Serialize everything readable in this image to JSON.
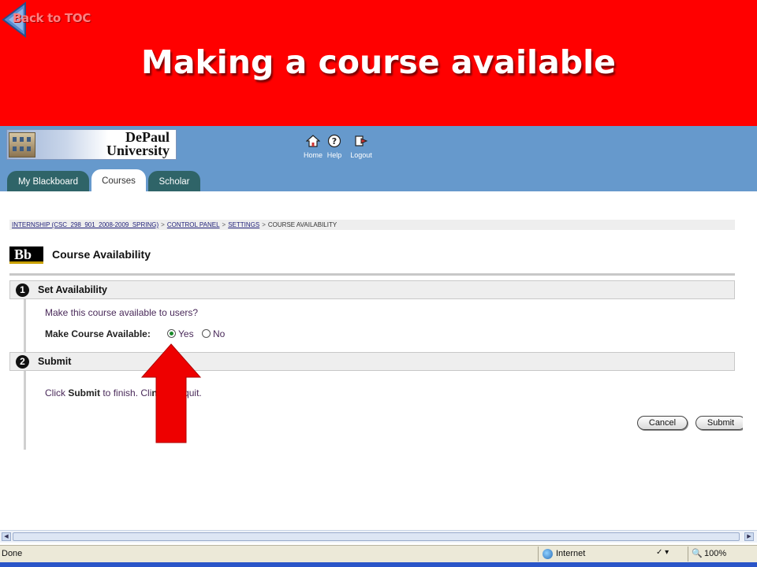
{
  "slide": {
    "back_link": "Back to TOC",
    "title": "Making a course available"
  },
  "header": {
    "logo_line1": "DePaul",
    "logo_line2": "University",
    "icons": [
      {
        "label": "Home",
        "icon": "home-icon"
      },
      {
        "label": "Help",
        "icon": "help-icon"
      },
      {
        "label": "Logout",
        "icon": "logout-icon"
      }
    ]
  },
  "tabs": [
    {
      "label": "My Blackboard",
      "active": false
    },
    {
      "label": "Courses",
      "active": true
    },
    {
      "label": "Scholar",
      "active": false
    }
  ],
  "breadcrumb": {
    "items": [
      "INTERNSHIP (CSC_298_901_2008-2009_SPRING)",
      "CONTROL PANEL",
      "SETTINGS",
      "COURSE AVAILABILITY"
    ],
    "separator": ">"
  },
  "page": {
    "logo_text": "Bb",
    "title": "Course Availability"
  },
  "step1": {
    "number": "1",
    "label": "Set Availability",
    "question": "Make this course available to users?",
    "field_label": "Make Course Available:",
    "options": [
      "Yes",
      "No"
    ],
    "selected": "Yes"
  },
  "step2": {
    "number": "2",
    "label": "Submit",
    "instr_pre": "Click ",
    "instr_submit": "Submit",
    "instr_mid": " to finish. Cli",
    "instr_cancel": "ncel",
    "instr_post": " to quit."
  },
  "buttons": {
    "cancel": "Cancel",
    "submit": "Submit"
  },
  "statusbar": {
    "status": "Done",
    "zone": "Internet",
    "protect": "✓ ▾",
    "zoom": "100%",
    "zoom_icon": "🔍"
  },
  "colors": {
    "slide_bg": "#ff0000",
    "bb_header": "#6699cc",
    "tab_dark": "#2f6468"
  }
}
